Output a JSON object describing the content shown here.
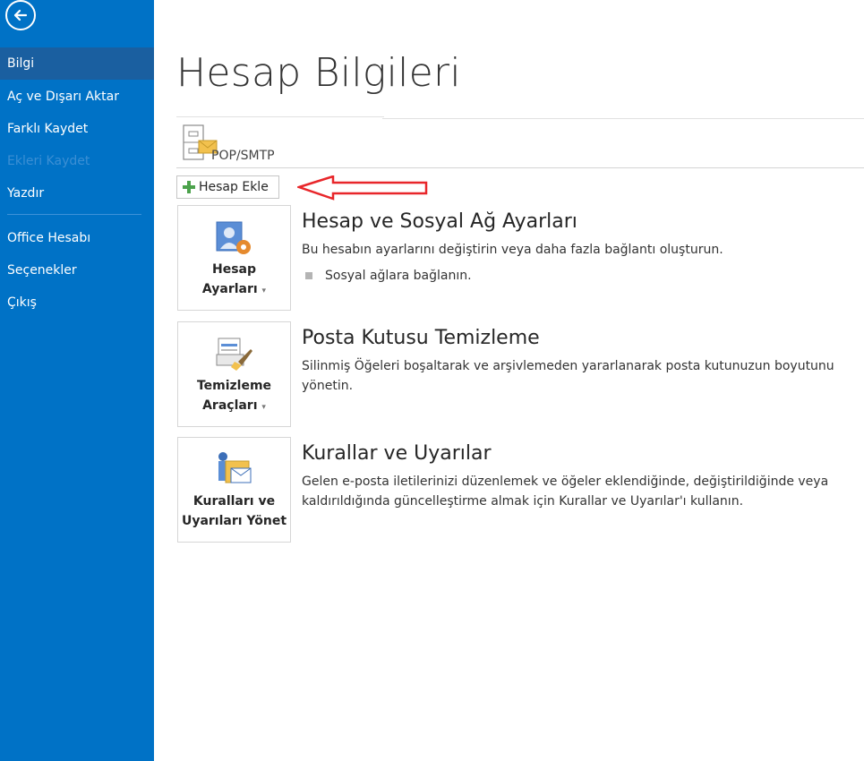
{
  "sidebar": {
    "items": [
      {
        "label": "Bilgi"
      },
      {
        "label": "Aç ve Dışarı Aktar"
      },
      {
        "label": "Farklı Kaydet"
      },
      {
        "label": "Ekleri Kaydet"
      },
      {
        "label": "Yazdır"
      },
      {
        "label": "Office Hesabı"
      },
      {
        "label": "Seçenekler"
      },
      {
        "label": "Çıkış"
      }
    ]
  },
  "main": {
    "title": "Hesap Bilgileri",
    "account": {
      "name": "POP/SMTP"
    },
    "add_account_label": "Hesap Ekle",
    "sections": [
      {
        "title": "Hesap ve Sosyal Ağ Ayarları",
        "desc1": "Bu hesabın ayarlarını değiştirin veya daha fazla bağlantı oluşturun.",
        "link": "Sosyal ağlara bağlanın.",
        "tile_line1": "Hesap",
        "tile_line2": "Ayarları"
      },
      {
        "title": "Posta Kutusu Temizleme",
        "desc1": "Silinmiş Öğeleri boşaltarak ve arşivlemeden yararlanarak posta kutunuzun boyutunu",
        "desc2": "yönetin.",
        "tile_line1": "Temizleme",
        "tile_line2": "Araçları"
      },
      {
        "title": "Kurallar ve Uyarılar",
        "desc1": "Gelen e-posta iletilerinizi düzenlemek ve öğeler eklendiğinde, değiştirildiğinde veya",
        "desc2": "kaldırıldığında güncelleştirme almak için Kurallar ve Uyarılar'ı kullanın.",
        "tile_line1": "Kuralları ve",
        "tile_line2": "Uyarıları Yönet"
      }
    ]
  },
  "colors": {
    "sidebar": "#0072c6",
    "selected": "#1a5fa0",
    "arrow": "#e8262a",
    "accent_green": "#4ca24c"
  }
}
